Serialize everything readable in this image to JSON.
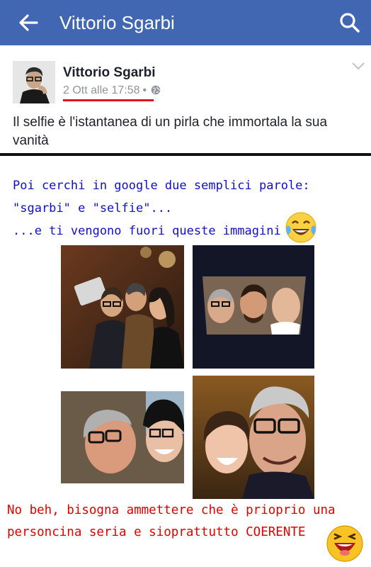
{
  "appbar": {
    "title": "Vittorio Sgarbi",
    "back_icon": "arrow-left-icon",
    "search_icon": "search-icon",
    "color": "#4267b2"
  },
  "post": {
    "author": "Vittorio Sgarbi",
    "date": "2 Ott alle 17:58",
    "separator": "•",
    "privacy_icon": "globe-icon",
    "menu_icon": "chevron-down-icon",
    "text": "Il selfie è l'istantanea di un pirla che immortala la sua vanità"
  },
  "meme": {
    "line1": "Poi cerchi in google due semplici parole:",
    "line2": "\"sgarbi\" e \"selfie\"...",
    "line3": "...e ti vengono fuori queste immagini",
    "bottom_line1": "No beh, bisogna ammettere che è prioprio una",
    "bottom_line2": "personcina seria e sioprattutto COERENTE",
    "blue_color": "#1010c8",
    "red_color": "#e00000",
    "emoji_top": "tears-of-joy-emoji",
    "emoji_bottom": "laughing-emoji"
  },
  "photos": [
    {
      "name": "selfie-photo-1"
    },
    {
      "name": "selfie-photo-2"
    },
    {
      "name": "selfie-photo-3"
    },
    {
      "name": "selfie-photo-4"
    }
  ]
}
